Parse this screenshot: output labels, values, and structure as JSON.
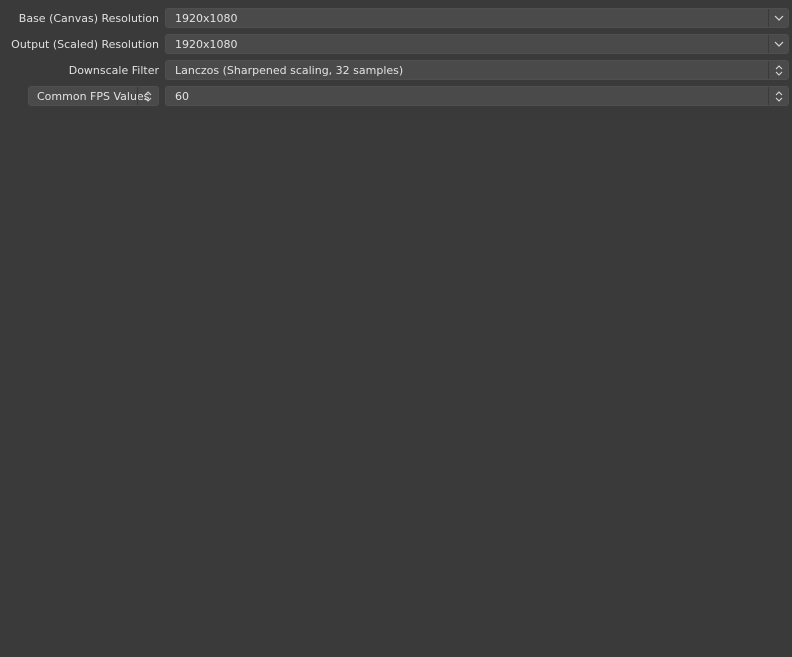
{
  "video_settings": {
    "base_resolution": {
      "label": "Base (Canvas) Resolution",
      "value": "1920x1080",
      "control_icon": "chevron-down-icon"
    },
    "output_resolution": {
      "label": "Output (Scaled) Resolution",
      "value": "1920x1080",
      "control_icon": "chevron-down-icon"
    },
    "downscale_filter": {
      "label": "Downscale Filter",
      "value": "Lanczos (Sharpened scaling, 32 samples)",
      "control_icon": "up-down-chevron-icon"
    },
    "fps": {
      "type_value": "Common FPS Values",
      "value": "60",
      "control_icon": "up-down-chevron-icon"
    }
  },
  "colors": {
    "background": "#3a3a3a",
    "control_background": "#4a4a4a",
    "text": "#e0e0e0"
  }
}
